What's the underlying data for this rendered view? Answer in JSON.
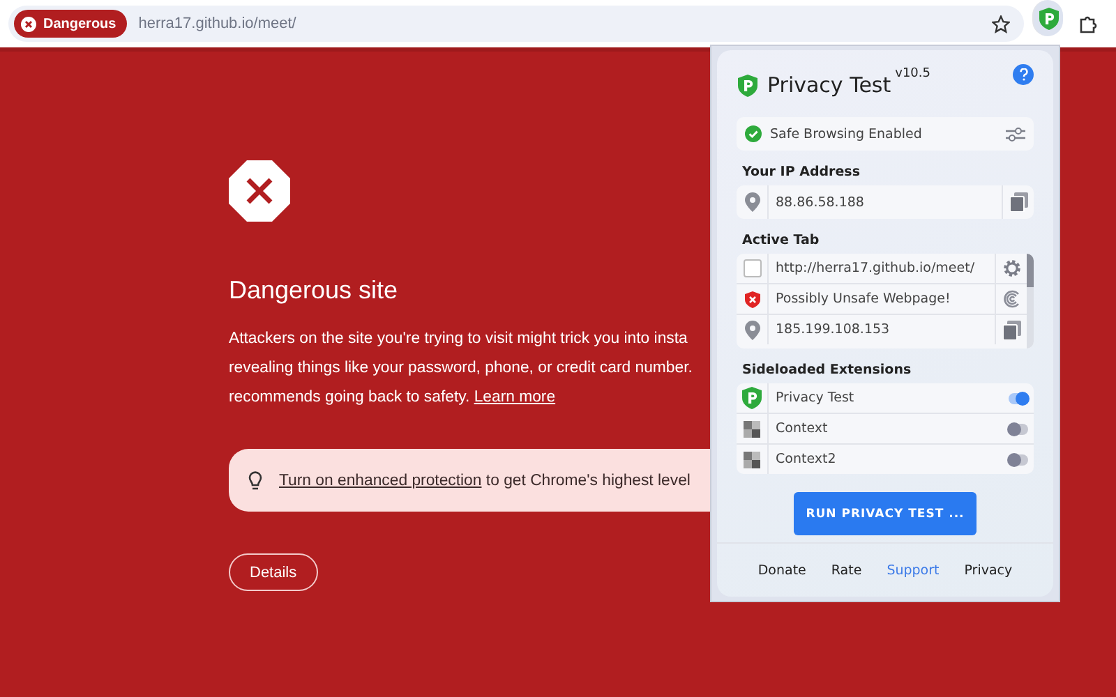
{
  "toolbar": {
    "security_chip": "Dangerous",
    "url": "herra17.github.io/meet/"
  },
  "warning": {
    "title": "Dangerous site",
    "paragraph_lines": [
      "Attackers on the site you're trying to visit might trick you into insta",
      "revealing things like your password, phone, or credit card number.",
      "recommends going back to safety."
    ],
    "link": "Learn more",
    "banner": {
      "link": "Turn on enhanced protection",
      "text": "to get Chrome's highest level"
    },
    "details_button": "Details"
  },
  "popup": {
    "title": "Privacy Test",
    "version": "v10.5",
    "status": "Safe Browsing Enabled",
    "ip_section": {
      "title": "Your IP Address",
      "value": "88.86.58.188"
    },
    "active_tab": {
      "title": "Active Tab",
      "rows": [
        {
          "kind": "url",
          "text": "http://herra17.github.io/meet/",
          "checked": false
        },
        {
          "kind": "warning",
          "text": "Possibly Unsafe Webpage!"
        },
        {
          "kind": "ip",
          "text": "185.199.108.153"
        }
      ]
    },
    "extensions": {
      "title": "Sideloaded Extensions",
      "items": [
        {
          "kind": "app",
          "name": "Privacy Test",
          "on": true
        },
        {
          "kind": "generic",
          "name": "Context",
          "on": false
        },
        {
          "kind": "generic",
          "name": "Context2",
          "on": false
        }
      ]
    },
    "run_button": "RUN PRIVACY TEST ...",
    "footer_links": [
      {
        "label": "Donate",
        "selected": false
      },
      {
        "label": "Rate",
        "selected": false
      },
      {
        "label": "Support",
        "selected": true
      },
      {
        "label": "Privacy",
        "selected": false
      }
    ]
  }
}
